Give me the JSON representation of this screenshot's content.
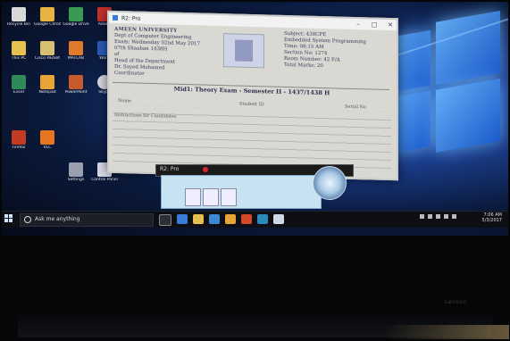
{
  "desktop": {
    "icons": [
      {
        "label": "Recycle Bin"
      },
      {
        "label": "Google Chrome"
      },
      {
        "label": "Google Drive"
      },
      {
        "label": "Adobe"
      },
      {
        "label": "This PC"
      },
      {
        "label": "Cisco Packet"
      },
      {
        "label": "MATLAB"
      },
      {
        "label": "Word"
      },
      {
        "label": "Excel"
      },
      {
        "label": "Notepad"
      },
      {
        "label": "PowerPoint"
      },
      {
        "label": "Skype"
      },
      {
        "label": "Firefox"
      },
      {
        "label": "VLC"
      },
      {
        "label": "Settings"
      },
      {
        "label": "Control Panel"
      }
    ]
  },
  "document_window": {
    "title": "R2: Pro",
    "university": "AMEEN UNIVERSITY",
    "department": "Dept of Computer Engineering",
    "date_line": "Exam: Wednesday 02nd May 2017",
    "shaban_line": "07th Shaaban 1438H",
    "left_extra_1": "of",
    "left_extra_2": "Head of the Department",
    "left_extra_3": "Dr. Sayed Mohamed",
    "left_extra_4": "Coordinator",
    "subject": "Subject: 438CPE",
    "subject_name": "Embedded System Programming",
    "time": "Time: 08:15 AM",
    "section": "Section No: 1274",
    "room": "Room Number: 42 F/A",
    "total_marks": "Total Marks: 20",
    "exam_title": "Mid1: Theory Exam - Semester II - 1437/1438 H",
    "col_name": "Name",
    "col_id": "Student ID",
    "col_serial": "Serial No",
    "instructions": "Instructions for Candidates"
  },
  "media_widget": {
    "label": "R2: Pro"
  },
  "taskbar": {
    "search_placeholder": "Ask me anything",
    "clock_time": "7:06 AM",
    "clock_date": "5/3/2017"
  },
  "bezel_brand": "Lenovo",
  "colors": {
    "wallpaper": "#1b3f8f",
    "taskbar": "#0d0f14",
    "document": "#d9d8d2"
  }
}
